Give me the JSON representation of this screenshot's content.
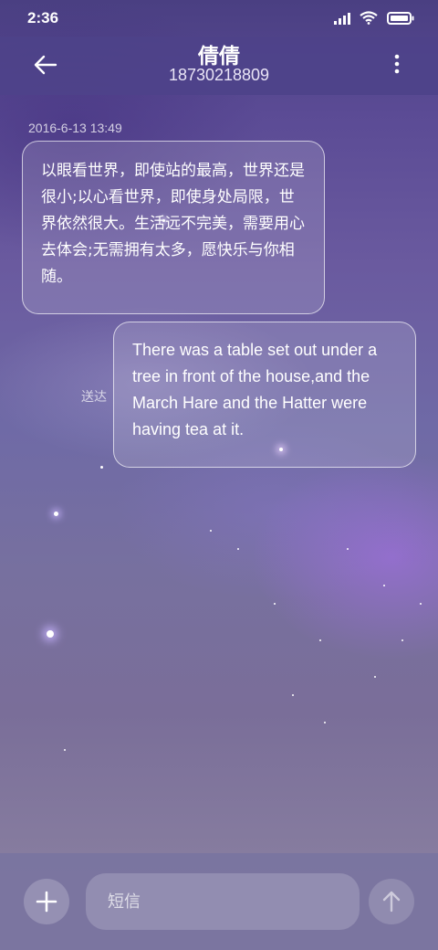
{
  "status_bar": {
    "time": "2:36"
  },
  "header": {
    "contact_name": "倩倩",
    "contact_number": "18730218809"
  },
  "conversation": {
    "timestamp": "2016-6-13 13:49",
    "messages": [
      {
        "direction": "incoming",
        "text": "以眼看世界，即使站的最高，世界还是很小;以心看世界，即使身处局限，世界依然很大。生活远不完美，需要用心去体会;无需拥有太多，愿快乐与你相随。"
      },
      {
        "direction": "outgoing",
        "text": "There was a table set out under a tree in front of the house,and the March Hare and the Hatter were having tea at it.",
        "status": "送达"
      }
    ]
  },
  "composer": {
    "placeholder": "短信",
    "value": ""
  },
  "icons": {
    "back": "arrow-left-icon",
    "more": "more-vertical-icon",
    "add": "plus-icon",
    "send": "arrow-up-icon",
    "signal": "signal-icon",
    "wifi": "wifi-icon",
    "battery": "battery-icon"
  },
  "colors": {
    "header_bg": "#4e428a",
    "bubble_border": "#ffffff",
    "text": "#ffffff"
  }
}
